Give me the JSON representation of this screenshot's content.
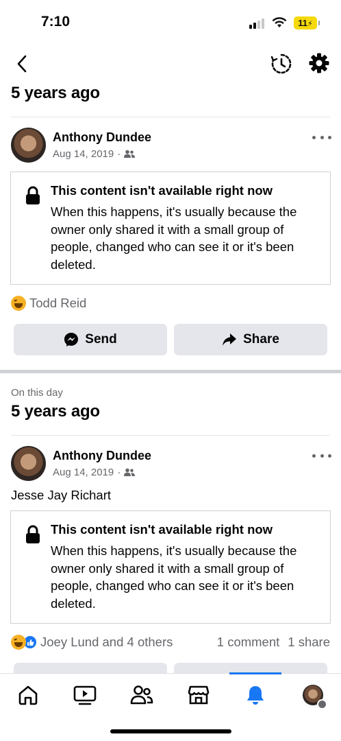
{
  "status_bar": {
    "time": "7:10",
    "battery": "11",
    "battery_color": "#f5d90a"
  },
  "header": {
    "back_icon": "chevron-left-icon",
    "history_icon": "clock-history-icon",
    "settings_icon": "gear-icon"
  },
  "memories": [
    {
      "subtitle": "",
      "title": "5 years ago",
      "post": {
        "author": "Anthony Dundee",
        "date": "Aug 14, 2019",
        "separator": "·",
        "audience_icon": "friends-icon",
        "text": "",
        "unavailable": {
          "title": "This content isn't available right now",
          "body": "When this happens, it's usually because the owner only shared it with a small group of people, changed who can see it or it's been deleted."
        },
        "reactions": {
          "icons": [
            "laugh-emoji"
          ],
          "names": "Todd Reid",
          "comments": "",
          "shares": ""
        },
        "actions": {
          "send": "Send",
          "share": "Share"
        }
      }
    },
    {
      "subtitle": "On this day",
      "title": "5 years ago",
      "post": {
        "author": "Anthony Dundee",
        "date": "Aug 14, 2019",
        "separator": "·",
        "audience_icon": "friends-icon",
        "text": "Jesse Jay Richart",
        "unavailable": {
          "title": "This content isn't available right now",
          "body": "When this happens, it's usually because the owner only shared it with a small group of people, changed who can see it or it's been deleted."
        },
        "reactions": {
          "icons": [
            "laugh-emoji",
            "like-emoji"
          ],
          "names": "Joey Lund and 4 others",
          "comments": "1 comment",
          "shares": "1 share"
        }
      }
    }
  ],
  "tab_bar": {
    "tabs": [
      "home-icon",
      "video-icon",
      "friends-icon",
      "marketplace-icon",
      "notifications-icon",
      "profile-menu"
    ],
    "active": "notifications-icon",
    "accent": "#1877f2"
  }
}
